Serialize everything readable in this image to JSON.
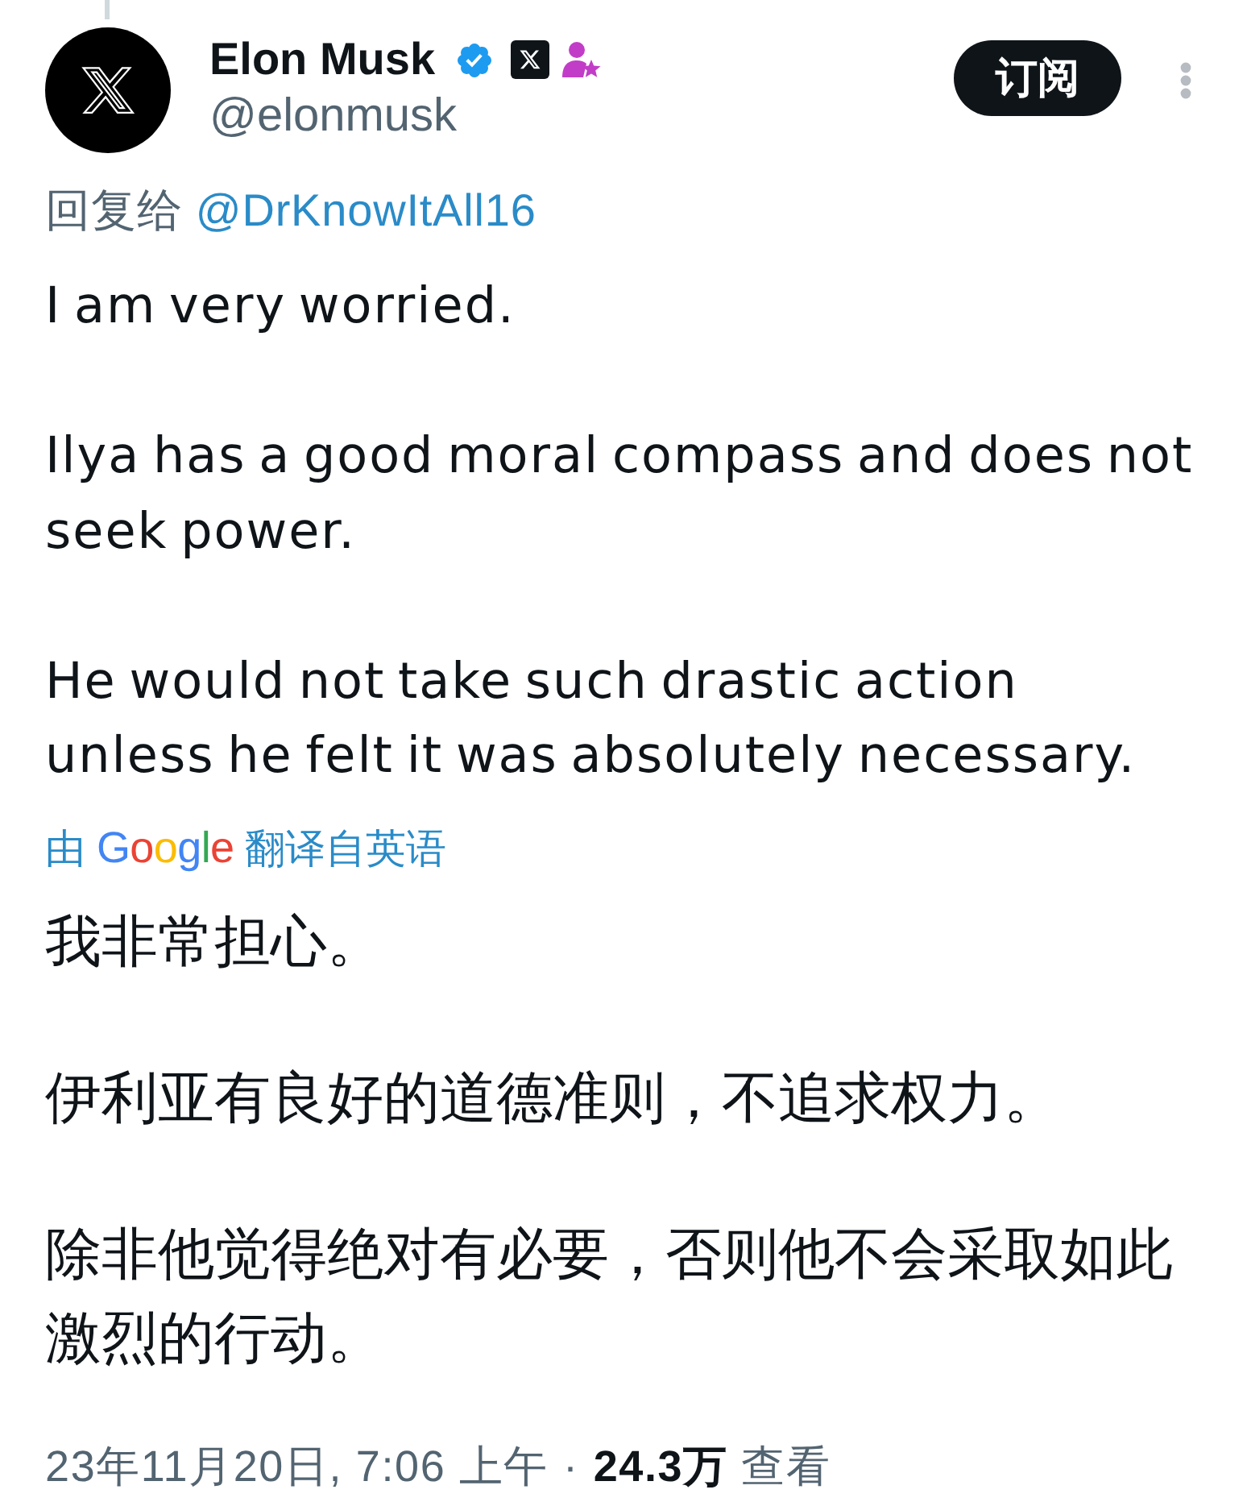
{
  "author": {
    "name": "Elon Musk",
    "handle": "@elonmusk",
    "verified": true
  },
  "subscribe_button": {
    "label": "订阅"
  },
  "reply_to": {
    "label": "回复给",
    "handle": "@DrKnowItAll16"
  },
  "tweet": {
    "paragraphs": [
      "I am very worried.",
      "Ilya has a good moral compass and does not seek power.",
      "He would not take such drastic action unless he felt it was absolutely necessary."
    ]
  },
  "translation": {
    "prefix": "由",
    "service": "Google",
    "suffix": "翻译自英语",
    "paragraphs": [
      "我非常担心。",
      "伊利亚有良好的道德准则，不追求权力。",
      "除非他觉得绝对有必要，否则他不会采取如此激烈的行动。"
    ]
  },
  "meta": {
    "timestamp": "23年11月20日, 7:06 上午",
    "separator": "·",
    "views": "**24.3万** 查看"
  }
}
